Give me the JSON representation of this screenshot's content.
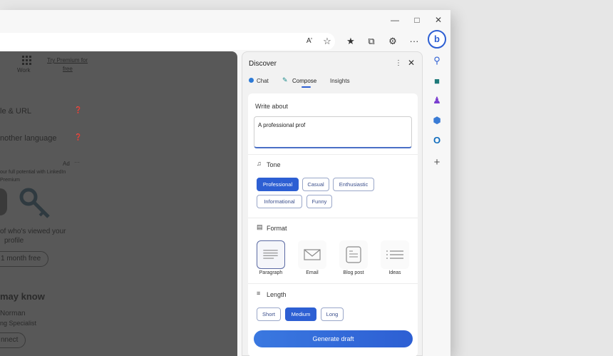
{
  "toolbar": {
    "read_aloud_label": "A’",
    "more_label": "···"
  },
  "page": {
    "work_label": "Work",
    "try_premium": "Try Premium for",
    "try_premium_2": "free",
    "item1": "le & URL",
    "item2": "nother language",
    "ad_label": "Ad",
    "promo_line1": "our full potential with LinkedIn",
    "promo_line2": "Premium",
    "viewed_line1": "of who's viewed your",
    "viewed_line2": "profile",
    "month_free": "1 month free",
    "may_know": "may know",
    "person_name": "Norman",
    "person_title": "ng Specialist",
    "connect": "nnect"
  },
  "panel": {
    "title": "Discover",
    "tabs": [
      "Chat",
      "Compose",
      "Insights"
    ],
    "write_about_label": "Write about",
    "write_about_value": "A professional prof",
    "tone_label": "Tone",
    "tone_options": [
      "Professional",
      "Casual",
      "Enthusiastic",
      "Informational",
      "Funny"
    ],
    "tone_selected": "Professional",
    "format_label": "Format",
    "format_options": [
      "Paragraph",
      "Email",
      "Blog post",
      "Ideas"
    ],
    "format_selected": "Paragraph",
    "length_label": "Length",
    "length_options": [
      "Short",
      "Medium",
      "Long"
    ],
    "length_selected": "Medium",
    "generate_label": "Generate draft"
  },
  "colors": {
    "accent": "#2d5fd3",
    "overlay": "#585858"
  }
}
